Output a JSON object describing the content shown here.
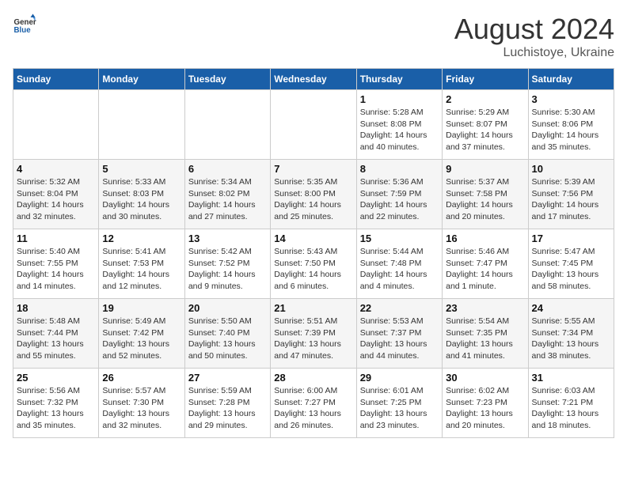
{
  "header": {
    "logo_general": "General",
    "logo_blue": "Blue",
    "month": "August 2024",
    "location": "Luchistoye, Ukraine"
  },
  "weekdays": [
    "Sunday",
    "Monday",
    "Tuesday",
    "Wednesday",
    "Thursday",
    "Friday",
    "Saturday"
  ],
  "weeks": [
    [
      {
        "day": "",
        "info": ""
      },
      {
        "day": "",
        "info": ""
      },
      {
        "day": "",
        "info": ""
      },
      {
        "day": "",
        "info": ""
      },
      {
        "day": "1",
        "info": "Sunrise: 5:28 AM\nSunset: 8:08 PM\nDaylight: 14 hours\nand 40 minutes."
      },
      {
        "day": "2",
        "info": "Sunrise: 5:29 AM\nSunset: 8:07 PM\nDaylight: 14 hours\nand 37 minutes."
      },
      {
        "day": "3",
        "info": "Sunrise: 5:30 AM\nSunset: 8:06 PM\nDaylight: 14 hours\nand 35 minutes."
      }
    ],
    [
      {
        "day": "4",
        "info": "Sunrise: 5:32 AM\nSunset: 8:04 PM\nDaylight: 14 hours\nand 32 minutes."
      },
      {
        "day": "5",
        "info": "Sunrise: 5:33 AM\nSunset: 8:03 PM\nDaylight: 14 hours\nand 30 minutes."
      },
      {
        "day": "6",
        "info": "Sunrise: 5:34 AM\nSunset: 8:02 PM\nDaylight: 14 hours\nand 27 minutes."
      },
      {
        "day": "7",
        "info": "Sunrise: 5:35 AM\nSunset: 8:00 PM\nDaylight: 14 hours\nand 25 minutes."
      },
      {
        "day": "8",
        "info": "Sunrise: 5:36 AM\nSunset: 7:59 PM\nDaylight: 14 hours\nand 22 minutes."
      },
      {
        "day": "9",
        "info": "Sunrise: 5:37 AM\nSunset: 7:58 PM\nDaylight: 14 hours\nand 20 minutes."
      },
      {
        "day": "10",
        "info": "Sunrise: 5:39 AM\nSunset: 7:56 PM\nDaylight: 14 hours\nand 17 minutes."
      }
    ],
    [
      {
        "day": "11",
        "info": "Sunrise: 5:40 AM\nSunset: 7:55 PM\nDaylight: 14 hours\nand 14 minutes."
      },
      {
        "day": "12",
        "info": "Sunrise: 5:41 AM\nSunset: 7:53 PM\nDaylight: 14 hours\nand 12 minutes."
      },
      {
        "day": "13",
        "info": "Sunrise: 5:42 AM\nSunset: 7:52 PM\nDaylight: 14 hours\nand 9 minutes."
      },
      {
        "day": "14",
        "info": "Sunrise: 5:43 AM\nSunset: 7:50 PM\nDaylight: 14 hours\nand 6 minutes."
      },
      {
        "day": "15",
        "info": "Sunrise: 5:44 AM\nSunset: 7:48 PM\nDaylight: 14 hours\nand 4 minutes."
      },
      {
        "day": "16",
        "info": "Sunrise: 5:46 AM\nSunset: 7:47 PM\nDaylight: 14 hours\nand 1 minute."
      },
      {
        "day": "17",
        "info": "Sunrise: 5:47 AM\nSunset: 7:45 PM\nDaylight: 13 hours\nand 58 minutes."
      }
    ],
    [
      {
        "day": "18",
        "info": "Sunrise: 5:48 AM\nSunset: 7:44 PM\nDaylight: 13 hours\nand 55 minutes."
      },
      {
        "day": "19",
        "info": "Sunrise: 5:49 AM\nSunset: 7:42 PM\nDaylight: 13 hours\nand 52 minutes."
      },
      {
        "day": "20",
        "info": "Sunrise: 5:50 AM\nSunset: 7:40 PM\nDaylight: 13 hours\nand 50 minutes."
      },
      {
        "day": "21",
        "info": "Sunrise: 5:51 AM\nSunset: 7:39 PM\nDaylight: 13 hours\nand 47 minutes."
      },
      {
        "day": "22",
        "info": "Sunrise: 5:53 AM\nSunset: 7:37 PM\nDaylight: 13 hours\nand 44 minutes."
      },
      {
        "day": "23",
        "info": "Sunrise: 5:54 AM\nSunset: 7:35 PM\nDaylight: 13 hours\nand 41 minutes."
      },
      {
        "day": "24",
        "info": "Sunrise: 5:55 AM\nSunset: 7:34 PM\nDaylight: 13 hours\nand 38 minutes."
      }
    ],
    [
      {
        "day": "25",
        "info": "Sunrise: 5:56 AM\nSunset: 7:32 PM\nDaylight: 13 hours\nand 35 minutes."
      },
      {
        "day": "26",
        "info": "Sunrise: 5:57 AM\nSunset: 7:30 PM\nDaylight: 13 hours\nand 32 minutes."
      },
      {
        "day": "27",
        "info": "Sunrise: 5:59 AM\nSunset: 7:28 PM\nDaylight: 13 hours\nand 29 minutes."
      },
      {
        "day": "28",
        "info": "Sunrise: 6:00 AM\nSunset: 7:27 PM\nDaylight: 13 hours\nand 26 minutes."
      },
      {
        "day": "29",
        "info": "Sunrise: 6:01 AM\nSunset: 7:25 PM\nDaylight: 13 hours\nand 23 minutes."
      },
      {
        "day": "30",
        "info": "Sunrise: 6:02 AM\nSunset: 7:23 PM\nDaylight: 13 hours\nand 20 minutes."
      },
      {
        "day": "31",
        "info": "Sunrise: 6:03 AM\nSunset: 7:21 PM\nDaylight: 13 hours\nand 18 minutes."
      }
    ]
  ]
}
